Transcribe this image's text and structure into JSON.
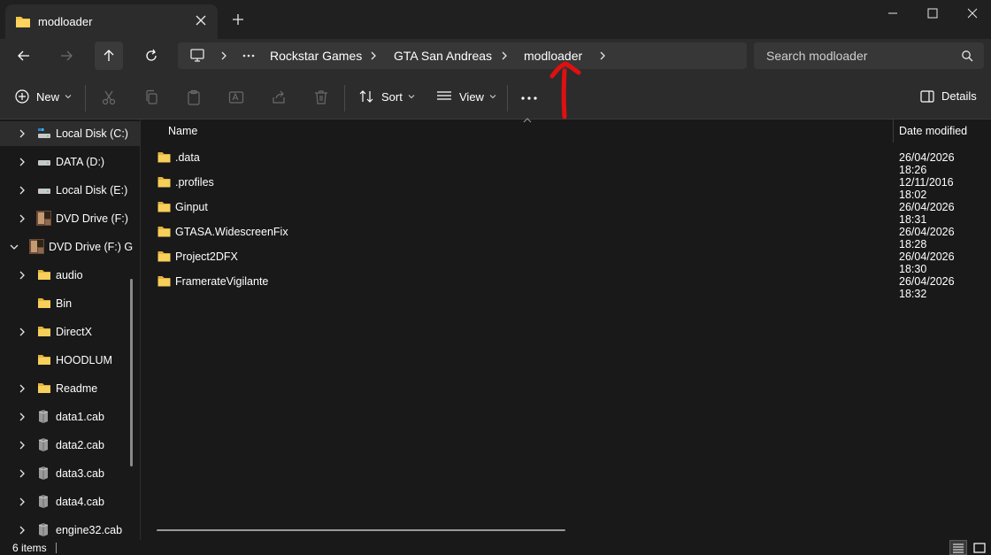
{
  "tab": {
    "title": "modloader"
  },
  "breadcrumb": [
    "Rockstar Games",
    "GTA San Andreas",
    "modloader"
  ],
  "search": {
    "placeholder": "Search modloader"
  },
  "toolbar": {
    "new_label": "New",
    "sort_label": "Sort",
    "view_label": "View",
    "details_label": "Details"
  },
  "sidebar": {
    "items": [
      {
        "label": "Local Disk (C:)",
        "icon": "drive-icon"
      },
      {
        "label": "DATA (D:)",
        "icon": "drive-icon"
      },
      {
        "label": "Local Disk (E:)",
        "icon": "drive-icon"
      },
      {
        "label": "DVD Drive (F:)",
        "icon": "dvd-icon"
      },
      {
        "label": "DVD Drive (F:) G",
        "icon": "dvd-icon"
      },
      {
        "label": "audio",
        "icon": "folder-icon"
      },
      {
        "label": "Bin",
        "icon": "folder-icon"
      },
      {
        "label": "DirectX",
        "icon": "folder-icon"
      },
      {
        "label": "HOODLUM",
        "icon": "folder-icon"
      },
      {
        "label": "Readme",
        "icon": "folder-icon"
      },
      {
        "label": "data1.cab",
        "icon": "file-icon"
      },
      {
        "label": "data2.cab",
        "icon": "file-icon"
      },
      {
        "label": "data3.cab",
        "icon": "file-icon"
      },
      {
        "label": "data4.cab",
        "icon": "file-icon"
      },
      {
        "label": "engine32.cab",
        "icon": "file-icon"
      }
    ]
  },
  "columns": {
    "name": "Name",
    "date": "Date modified"
  },
  "files": [
    {
      "name": ".data",
      "date": "26/04/2026 18:26"
    },
    {
      "name": ".profiles",
      "date": "12/11/2016 18:02"
    },
    {
      "name": "Ginput",
      "date": "26/04/2026 18:31"
    },
    {
      "name": "GTASA.WidescreenFix",
      "date": "26/04/2026 18:28"
    },
    {
      "name": "Project2DFX",
      "date": "26/04/2026 18:30"
    },
    {
      "name": "FramerateVigilante",
      "date": "26/04/2026 18:32"
    }
  ],
  "status": {
    "count": "6 items"
  },
  "colors": {
    "accent": "#60cdff",
    "folder": "#f3c44d",
    "annotation": "#e01010"
  }
}
